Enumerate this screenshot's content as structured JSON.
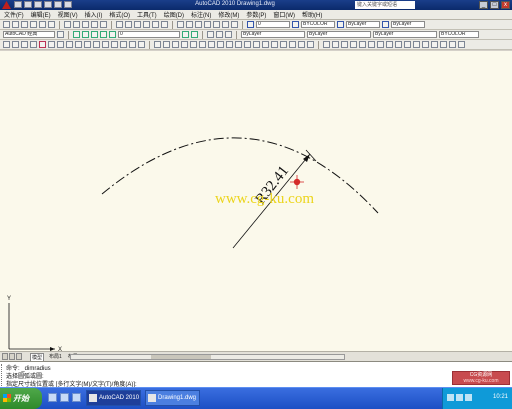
{
  "window": {
    "title": "AutoCAD 2010  Drawing1.dwg",
    "search_placeholder": "键入关键字或短语",
    "controls": {
      "minimize": "_",
      "maximize": "□",
      "close": "x"
    }
  },
  "menu": {
    "items": [
      "文件(F)",
      "编辑(E)",
      "视图(V)",
      "插入(I)",
      "格式(O)",
      "工具(T)",
      "绘图(D)",
      "标注(N)",
      "修改(M)",
      "参数(P)",
      "窗口(W)",
      "帮助(H)"
    ]
  },
  "toolbars": {
    "workspace": "AutoCAD 经典",
    "layer": "0",
    "color": "ByLayer",
    "linetype": "ByLayer",
    "lineweight": "ByLayer",
    "plotstyle": "BYCOLOR"
  },
  "drawing": {
    "dimension_text": "R32.41",
    "watermark": "www.cg-ku.com",
    "ucs": {
      "y_label": "Y",
      "x_label": "X"
    },
    "colors": {
      "background": "#fbf9eb",
      "geometry": "#111111",
      "marker": "#d42a2a",
      "watermark": "#ecd51c"
    }
  },
  "layout_tabs": {
    "items": [
      "模型",
      "布局1",
      "布局2"
    ],
    "active_index": 0
  },
  "command_line": {
    "lines": [
      "命令: _dimradius",
      "选择圆弧或圆:",
      "指定尺寸线位置或 [多行文字(M)/文字(T)/角度(A)]:"
    ]
  },
  "status_ad": {
    "line1": "CG资源网",
    "line2": "www.cg-ku.com"
  },
  "taskbar": {
    "start_label": "开始",
    "tasks": [
      {
        "label": "AutoCAD 2010"
      },
      {
        "label": "Drawing1.dwg"
      }
    ],
    "clock": "10:21"
  }
}
